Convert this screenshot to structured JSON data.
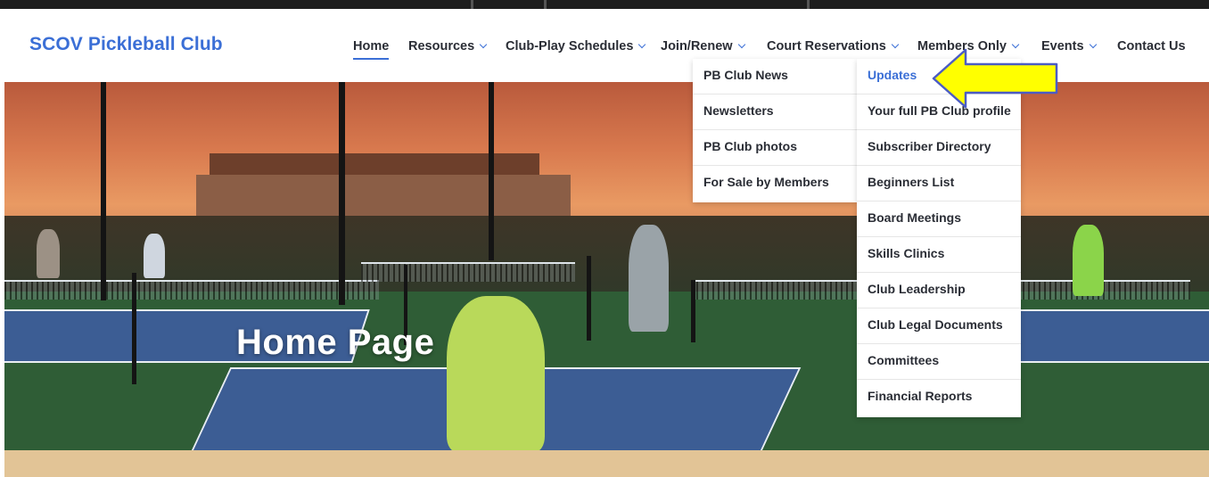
{
  "site": {
    "logo_text": "SCOV Pickleball Club"
  },
  "nav": {
    "items": [
      {
        "label": "Home",
        "has_dropdown": false,
        "active": true
      },
      {
        "label": "Resources",
        "has_dropdown": true
      },
      {
        "label": "Club-Play Schedules",
        "has_dropdown": true
      },
      {
        "label": "Join/Renew",
        "has_dropdown": true
      },
      {
        "label": "Court Reservations",
        "has_dropdown": true
      },
      {
        "label": "Members Only",
        "has_dropdown": true
      },
      {
        "label": "Events",
        "has_dropdown": true
      },
      {
        "label": "Contact Us",
        "has_dropdown": false
      }
    ]
  },
  "dropdown_left": {
    "items": [
      "PB Club News",
      "Newsletters",
      "PB Club photos",
      "For Sale by Members"
    ]
  },
  "dropdown_right": {
    "items": [
      "Updates",
      "Your full PB Club profile",
      "Subscriber Directory",
      "Beginners List",
      "Board Meetings",
      "Skills Clinics",
      "Club Leadership",
      "Club Legal Documents",
      "Committees",
      "Financial Reports"
    ],
    "active_item": "Updates"
  },
  "hero": {
    "title": "Home Page"
  },
  "annotation": {
    "arrow_color": "#ffff00",
    "arrow_outline": "#4b5cc4"
  },
  "colors": {
    "accent": "#3b6fd6",
    "footer_band": "#e2c496"
  }
}
